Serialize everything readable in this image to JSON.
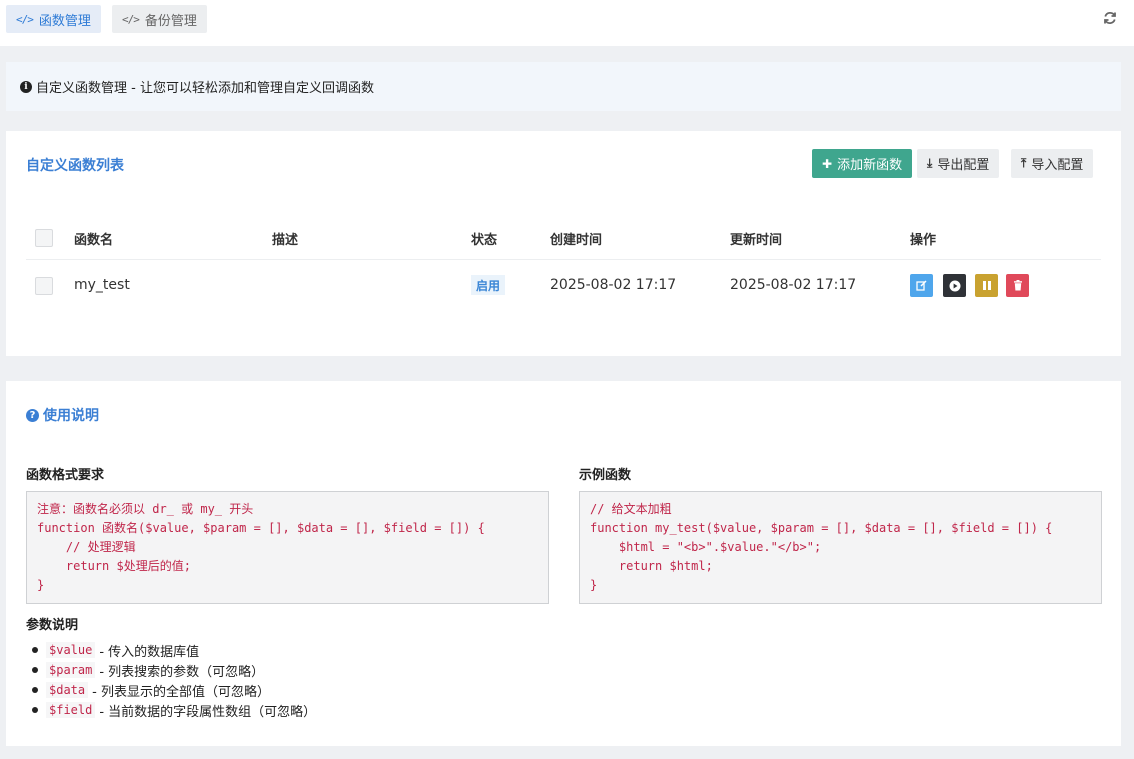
{
  "tabs": [
    {
      "label": "函数管理",
      "icon": "code-icon"
    },
    {
      "label": "备份管理",
      "icon": "code-icon"
    }
  ],
  "alert": {
    "text": "自定义函数管理 - 让您可以轻松添加和管理自定义回调函数"
  },
  "list": {
    "title": "自定义函数列表",
    "buttons": {
      "add": "添加新函数",
      "export": "导出配置",
      "import": "导入配置"
    },
    "columns": [
      "函数名",
      "描述",
      "状态",
      "创建时间",
      "更新时间",
      "操作"
    ],
    "rows": [
      {
        "name": "my_test",
        "description": "",
        "status": "启用",
        "created": "2025-08-02 17:17",
        "updated": "2025-08-02 17:17"
      }
    ]
  },
  "help": {
    "title": "使用说明",
    "format_title": "函数格式要求",
    "format_code": "注意：函数名必须以 dr_ 或 my_ 开头\nfunction 函数名($value, $param = [], $data = [], $field = []) {\n    // 处理逻辑\n    return $处理后的值;\n}",
    "example_title": "示例函数",
    "example_code": "// 给文本加粗\nfunction my_test($value, $param = [], $data = [], $field = []) {\n    $html = \"<b>\".$value.\"</b>\";\n    return $html;\n}",
    "params_title": "参数说明",
    "params": [
      {
        "code": "$value",
        "desc": "- 传入的数据库值"
      },
      {
        "code": "$param",
        "desc": "- 列表搜索的参数（可忽略）"
      },
      {
        "code": "$data",
        "desc": "- 列表显示的全部值（可忽略）"
      },
      {
        "code": "$field",
        "desc": "- 当前数据的字段属性数组（可忽略）"
      }
    ]
  },
  "colors": {
    "accent": "#3b7fd4",
    "add_button": "#3fa68e",
    "edit": "#4fa6ec",
    "run": "#2f3237",
    "pause": "#c9a230",
    "delete": "#e0495a"
  }
}
